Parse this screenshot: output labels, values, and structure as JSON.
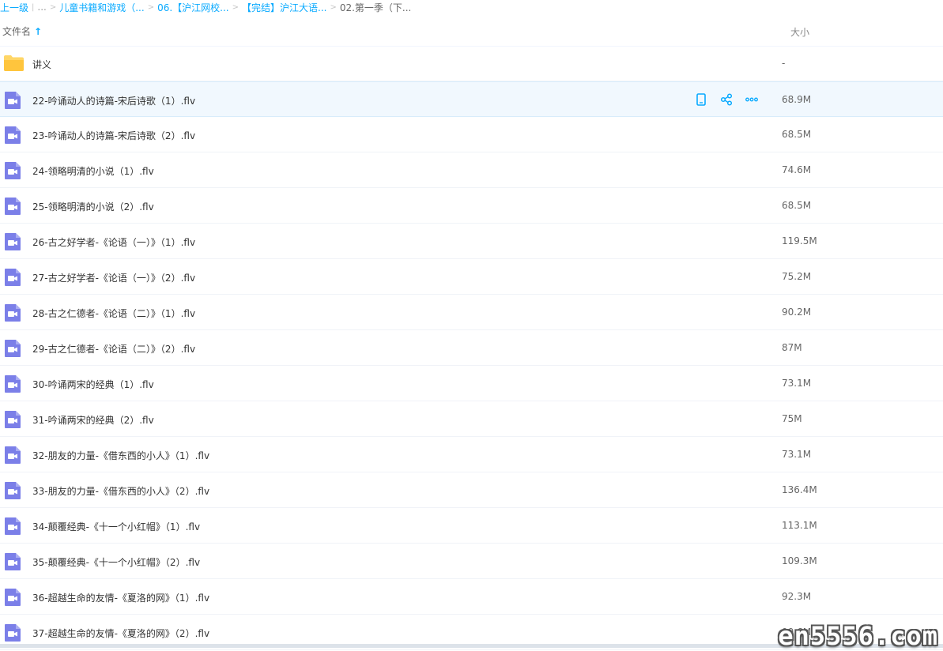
{
  "breadcrumb": {
    "back": "上一级",
    "ellipsis": "...",
    "items": [
      "儿童书籍和游戏（...",
      "06.【沪江网校...",
      "【完结】沪江大语..."
    ],
    "current": "02.第一季（下..."
  },
  "columns": {
    "name": "文件名",
    "sort_arrow": "↑",
    "size": "大小"
  },
  "colors": {
    "accent": "#09aaff",
    "folder": "#ffd666",
    "video": "#7b7fe8"
  },
  "files": [
    {
      "name": "讲义",
      "size": "-",
      "type": "folder"
    },
    {
      "name": "22-吟诵动人的诗篇-宋后诗歌（1）.flv",
      "size": "68.9M",
      "type": "video"
    },
    {
      "name": "23-吟诵动人的诗篇-宋后诗歌（2）.flv",
      "size": "68.5M",
      "type": "video"
    },
    {
      "name": "24-领略明清的小说（1）.flv",
      "size": "74.6M",
      "type": "video"
    },
    {
      "name": "25-领略明清的小说（2）.flv",
      "size": "68.5M",
      "type": "video"
    },
    {
      "name": "26-古之好学者-《论语（一）》（1）.flv",
      "size": "119.5M",
      "type": "video"
    },
    {
      "name": "27-古之好学者-《论语（一）》（2）.flv",
      "size": "75.2M",
      "type": "video"
    },
    {
      "name": "28-古之仁德者-《论语（二）》（1）.flv",
      "size": "90.2M",
      "type": "video"
    },
    {
      "name": "29-古之仁德者-《论语（二）》（2）.flv",
      "size": "87M",
      "type": "video"
    },
    {
      "name": "30-吟诵两宋的经典（1）.flv",
      "size": "73.1M",
      "type": "video"
    },
    {
      "name": "31-吟诵两宋的经典（2）.flv",
      "size": "75M",
      "type": "video"
    },
    {
      "name": "32-朋友的力量-《借东西的小人》（1）.flv",
      "size": "73.1M",
      "type": "video"
    },
    {
      "name": "33-朋友的力量-《借东西的小人》（2）.flv",
      "size": "136.4M",
      "type": "video"
    },
    {
      "name": "34-颠覆经典-《十一个小红帽》（1）.flv",
      "size": "113.1M",
      "type": "video"
    },
    {
      "name": "35-颠覆经典-《十一个小红帽》（2）.flv",
      "size": "109.3M",
      "type": "video"
    },
    {
      "name": "36-超越生命的友情-《夏洛的网》（1）.flv",
      "size": "92.3M",
      "type": "video"
    },
    {
      "name": "37-超越生命的友情-《夏洛的网》（2）.flv",
      "size": "90.6M",
      "type": "video"
    }
  ],
  "row_actions": [
    "phone-icon",
    "share-icon",
    "more-icon"
  ],
  "watermark": "en5556.com"
}
